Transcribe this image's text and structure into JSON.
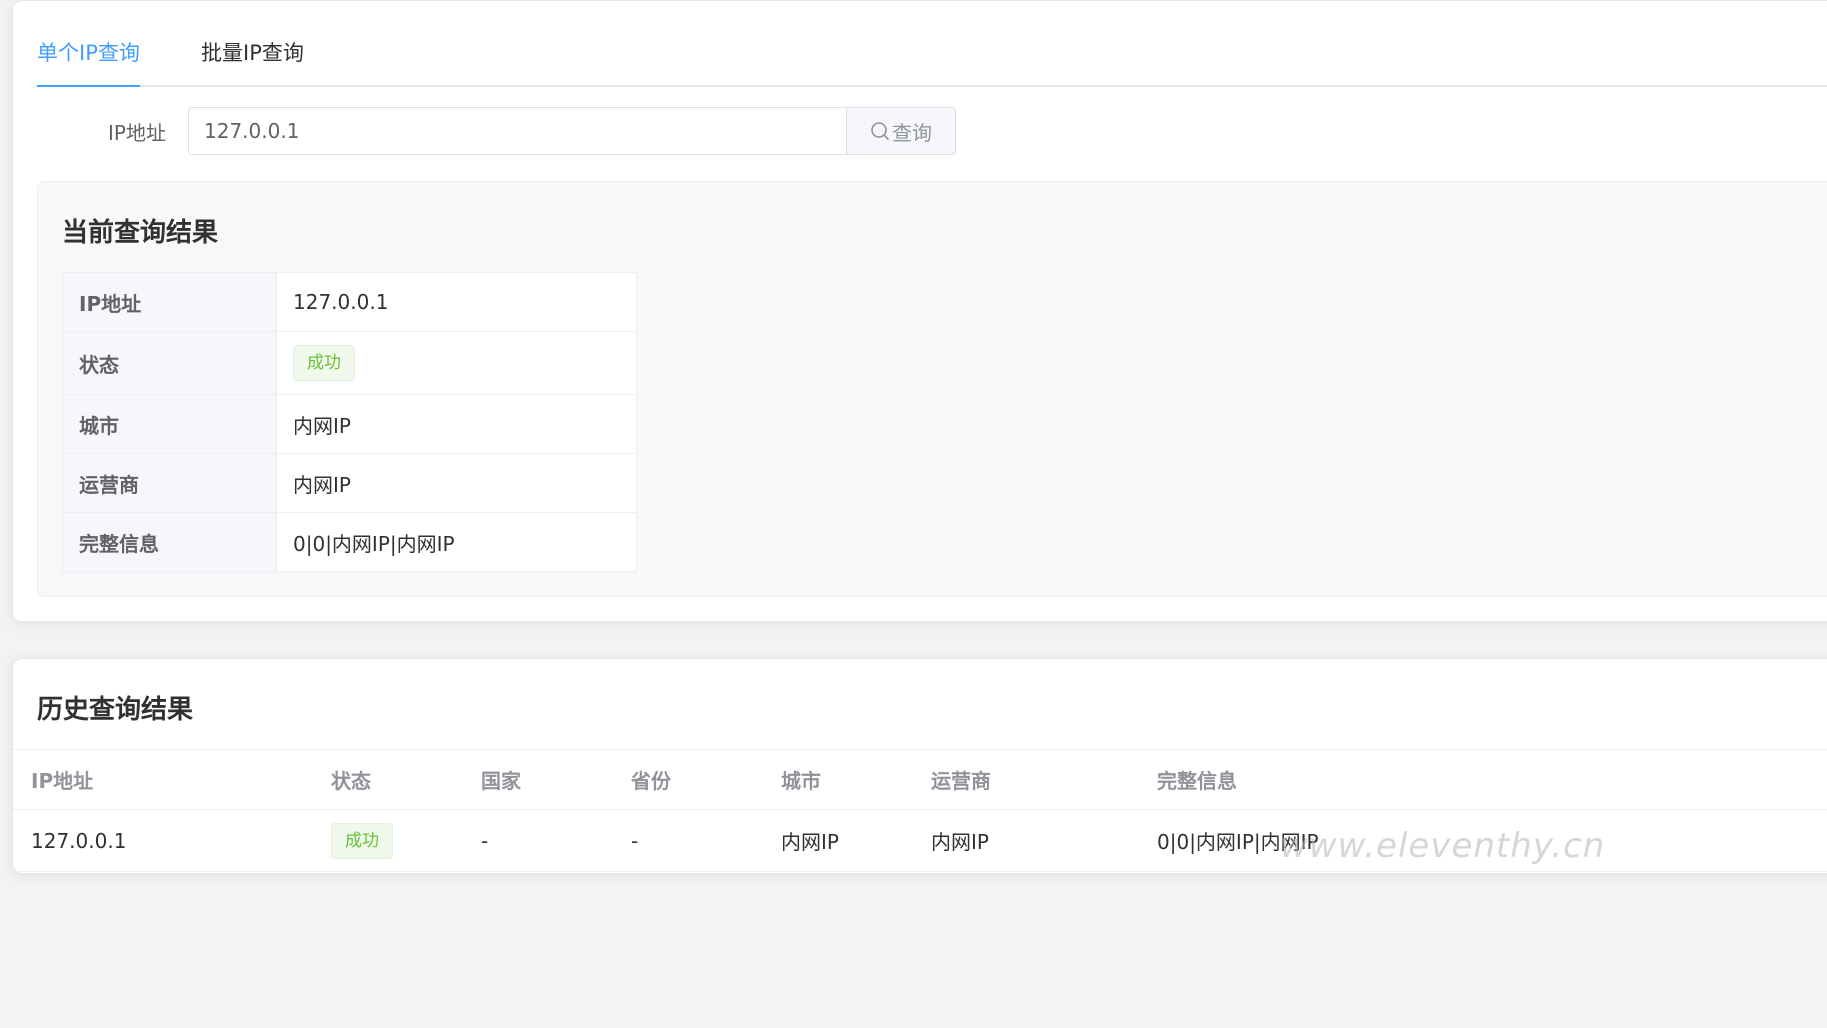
{
  "tabs": [
    {
      "label": "单个IP查询",
      "active": true
    },
    {
      "label": "批量IP查询",
      "active": false
    }
  ],
  "form": {
    "label": "IP地址",
    "ip_value": "127.0.0.1",
    "query_button": "查询"
  },
  "current_result": {
    "title": "当前查询结果",
    "rows": [
      {
        "key": "IP地址",
        "value": "127.0.0.1"
      },
      {
        "key": "状态",
        "value": "成功"
      },
      {
        "key": "城市",
        "value": "内网IP"
      },
      {
        "key": "运营商",
        "value": "内网IP"
      },
      {
        "key": "完整信息",
        "value": "0|0|内网IP|内网IP"
      }
    ]
  },
  "history": {
    "title": "历史查询结果",
    "columns": [
      "IP地址",
      "状态",
      "国家",
      "省份",
      "城市",
      "运营商",
      "完整信息"
    ],
    "rows": [
      [
        "127.0.0.1",
        "成功",
        "-",
        "-",
        "内网IP",
        "内网IP",
        "0|0|内网IP|内网IP"
      ]
    ]
  },
  "watermark": "www.eleventhy.cn",
  "colors": {
    "accent": "#409eff",
    "success_text": "#67c23a",
    "success_bg": "#f0f9eb"
  }
}
